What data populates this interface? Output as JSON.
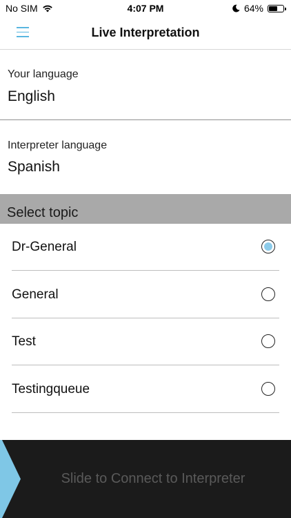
{
  "status_bar": {
    "carrier": "No SIM",
    "time": "4:07 PM",
    "battery_percent": "64%",
    "battery_level": 0.64,
    "icons": [
      "wifi-icon",
      "moon-icon",
      "battery-icon"
    ]
  },
  "nav": {
    "title": "Live Interpretation",
    "menu_icon": "hamburger-menu-icon"
  },
  "your_language": {
    "label": "Your language",
    "value": "English"
  },
  "interpreter_language": {
    "label": "Interpreter language",
    "value": "Spanish"
  },
  "topics": {
    "header": "Select topic",
    "items": [
      {
        "label": "Dr-General",
        "selected": true
      },
      {
        "label": "General",
        "selected": false
      },
      {
        "label": "Test",
        "selected": false
      },
      {
        "label": "Testingqueue",
        "selected": false
      }
    ]
  },
  "slider": {
    "label": "Slide to Connect to Interpreter"
  },
  "colors": {
    "accent": "#59b6e0",
    "radio_selected": "#8ccbea",
    "slider_bg": "#1b1b1b",
    "slider_handle": "#7fc7e6",
    "topic_header_bg": "#a9a9a9"
  }
}
